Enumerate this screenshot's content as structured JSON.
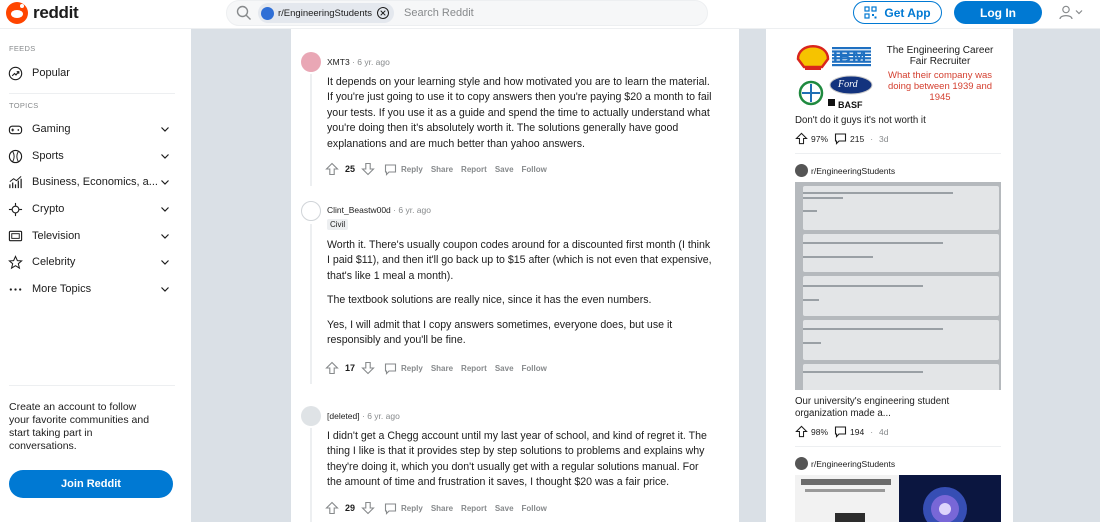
{
  "header": {
    "logo_text": "reddit",
    "search_chip": "r/EngineeringStudents",
    "search_placeholder": "Search Reddit",
    "get_app": "Get App",
    "login": "Log In"
  },
  "sidebar": {
    "feeds_title": "FEEDS",
    "popular": "Popular",
    "topics_title": "TOPICS",
    "topics": [
      {
        "label": "Gaming",
        "icon": "gamepad-icon"
      },
      {
        "label": "Sports",
        "icon": "ball-icon"
      },
      {
        "label": "Business, Economics, a...",
        "icon": "chart-icon"
      },
      {
        "label": "Crypto",
        "icon": "crypto-icon"
      },
      {
        "label": "Television",
        "icon": "tv-icon"
      },
      {
        "label": "Celebrity",
        "icon": "star-icon"
      },
      {
        "label": "More Topics",
        "icon": "more-icon"
      }
    ],
    "cta_text": "Create an account to follow your favorite communities and start taking part in conversations.",
    "join": "Join Reddit"
  },
  "comments": [
    {
      "author": "XMT3",
      "time": "6 yr. ago",
      "flair": "",
      "paragraphs": [
        "It depends on your learning style and how motivated you are to learn the material. If you're just going to use it to copy answers then you're paying $20 a month to fail your tests. If you use it as a guide and spend the time to actually understand what you're doing then it's absolutely worth it. The solutions generally have good explanations and are much better than yahoo answers."
      ],
      "score": "25"
    },
    {
      "author": "Clint_Beastw00d",
      "time": "6 yr. ago",
      "flair": "Civil",
      "paragraphs": [
        "Worth it. There's usually coupon codes around for a discounted first month (I think I paid $11), and then it'll go back up to $15 after (which is not even that expensive, that's like 1 meal a month).",
        "The textbook solutions are really nice, since it has the even numbers.",
        "Yes, I will admit that I copy answers sometimes, everyone does, but use it responsibly and you'll be fine."
      ],
      "score": "17"
    },
    {
      "author": "[deleted]",
      "time": "6 yr. ago",
      "flair": "",
      "paragraphs": [
        "I didn't get a Chegg account until my last year of school, and kind of regret it. The thing I like is that it provides step by step solutions to problems and explains why they're doing it, which you don't usually get with a regular solutions manual. For the amount of time and frustration it saves, I thought $20 was a fair price."
      ],
      "score": "29"
    }
  ],
  "actions": {
    "reply": "Reply",
    "share": "Share",
    "report": "Report",
    "save": "Save",
    "follow": "Follow"
  },
  "rail": {
    "ad": {
      "brand": "IBM",
      "headline": "The Engineering Career Fair Recruiter",
      "red_text": "What their company was doing between 1939 and 1945",
      "basf": "BASF",
      "ford": "Ford"
    },
    "posts": [
      {
        "subreddit": "",
        "title": "Don't do it guys it's not worth it",
        "upvote": "97%",
        "comments": "215",
        "age": "3d"
      },
      {
        "subreddit": "r/EngineeringStudents",
        "title": "Our university's engineering student organization made a...",
        "upvote": "98%",
        "comments": "194",
        "age": "4d"
      },
      {
        "subreddit": "r/EngineeringStudents",
        "title": "",
        "upvote": "",
        "comments": "",
        "age": ""
      }
    ]
  },
  "colors": {
    "accent": "#0079d3",
    "brand": "#ff4500",
    "background": "#dae0e6"
  }
}
